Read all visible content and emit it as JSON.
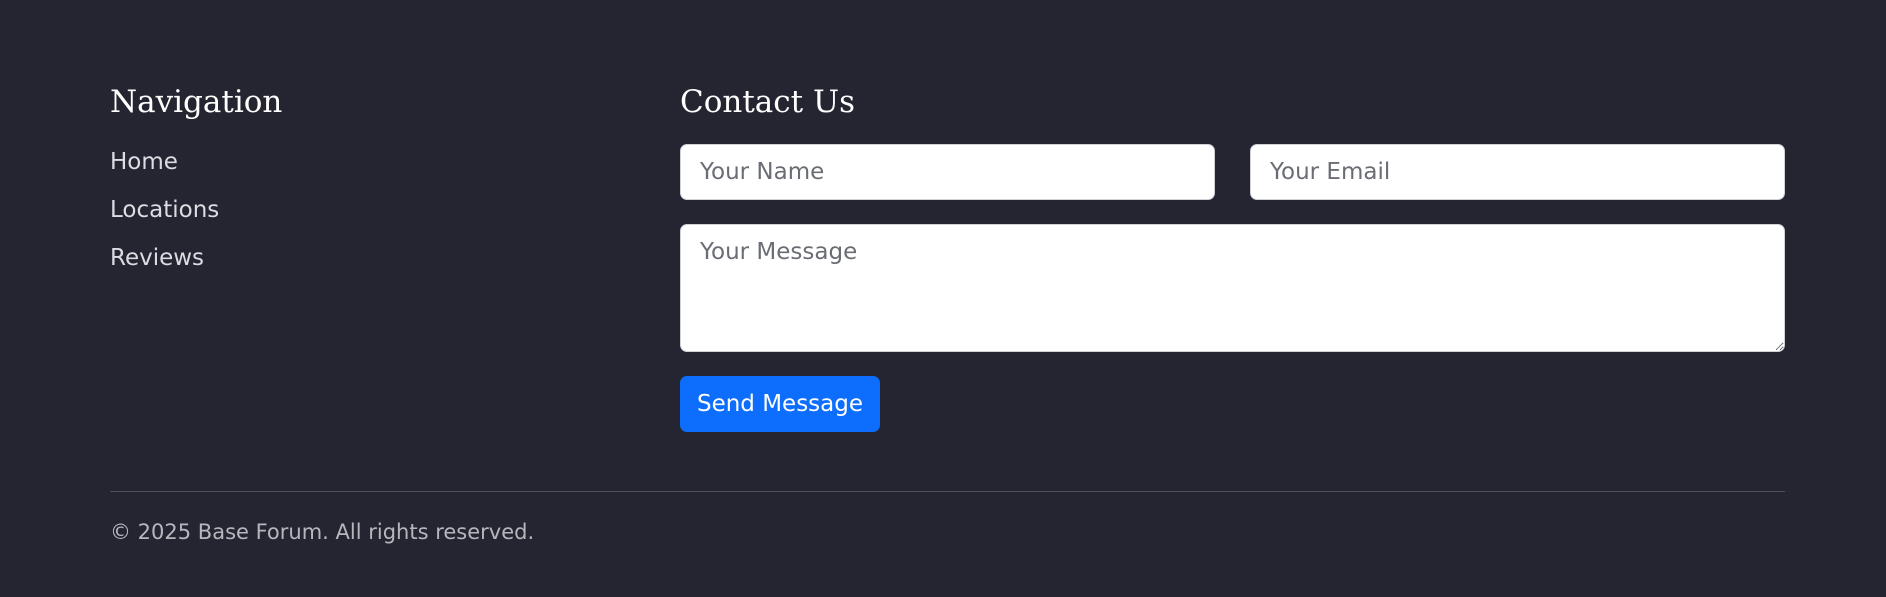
{
  "navigation": {
    "title": "Navigation",
    "items": [
      {
        "label": "Home"
      },
      {
        "label": "Locations"
      },
      {
        "label": "Reviews"
      }
    ]
  },
  "contact": {
    "title": "Contact Us",
    "name_placeholder": "Your Name",
    "email_placeholder": "Your Email",
    "message_placeholder": "Your Message",
    "send_label": "Send Message"
  },
  "footer": {
    "copyright": "© 2025 Base Forum. All rights reserved."
  },
  "colors": {
    "background": "#242530",
    "accent": "#0d6efd"
  }
}
